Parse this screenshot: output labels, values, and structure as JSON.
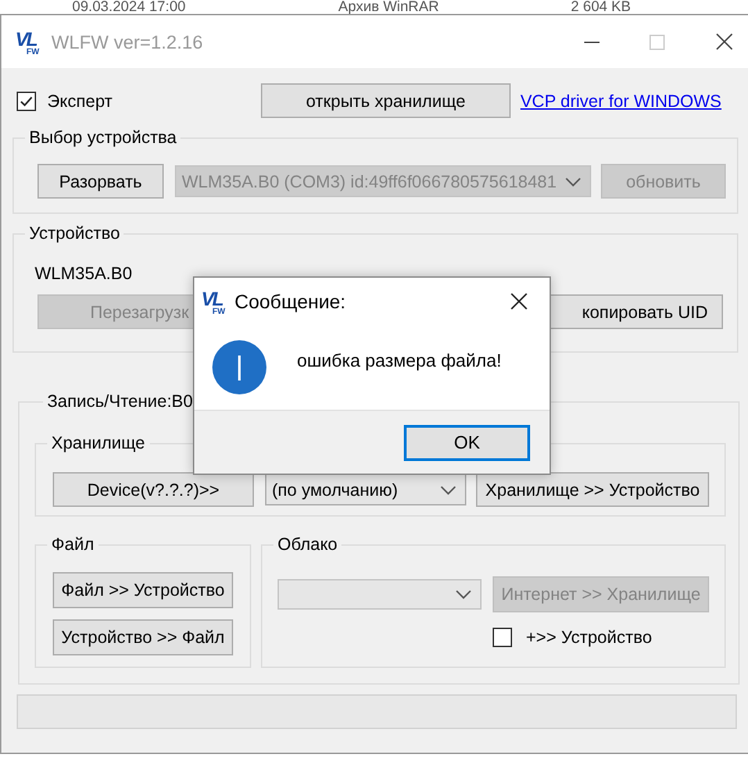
{
  "background_row": {
    "date": "09.03.2024 17:00",
    "type": "Архив WinRAR",
    "size": "2 604 KB"
  },
  "window": {
    "title": "WLFW ver=1.2.16",
    "logo": {
      "main": "VL",
      "sub": "FW"
    }
  },
  "expert": {
    "label": "Эксперт",
    "checked": true
  },
  "open_storage_button": "открыть хранилище",
  "vcp_link": "VCP driver for WINDOWS",
  "device_select": {
    "title": "Выбор устройства",
    "disconnect_button": "Разорвать",
    "port": {
      "value": "WLM35A.B0 (COM3) id:49ff6f066780575618481",
      "disabled": true
    },
    "refresh_button": {
      "label": "обновить",
      "disabled": true
    }
  },
  "device": {
    "title": "Устройство",
    "name": "WLM35A.B0",
    "reboot_button": {
      "label": "Перезагрузк",
      "disabled": true
    },
    "copy_uid_button": {
      "label": "копировать UID",
      "disabled": false
    }
  },
  "read_write": {
    "title": "Запись/Чтение:B0",
    "storage": {
      "title": "Хранилище",
      "device_button": "Device(v?.?.?)>>",
      "mode": {
        "value": "(по умолчанию)"
      },
      "storage_to_device_button": "Хранилище >> Устройство"
    },
    "file": {
      "title": "Файл",
      "buttons": [
        "Файл >> Устройство",
        "Устройство >> Файл"
      ]
    },
    "cloud": {
      "title": "Облако",
      "source": {
        "disabled": true
      },
      "internet_button": {
        "label": "Интернет >> Хранилище",
        "disabled": true
      },
      "to_device": {
        "label": "+>> Устройство",
        "checked": false
      }
    }
  },
  "dialog": {
    "logo": {
      "main": "VL",
      "sub": "FW"
    },
    "title": "Сообщение:",
    "message": "ошибка размера файла!",
    "ok_button": "OK"
  }
}
